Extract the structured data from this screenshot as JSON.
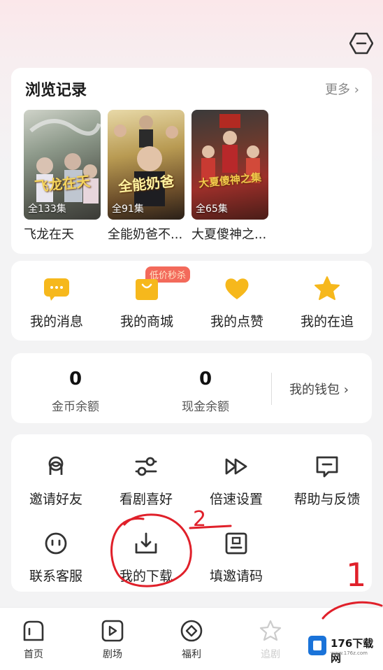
{
  "history": {
    "title": "浏览记录",
    "more": "更多",
    "items": [
      {
        "title": "飞龙在天",
        "episodes": "全133集",
        "poster_text": "飞龙在天"
      },
      {
        "title": "全能奶爸不...",
        "episodes": "全91集",
        "poster_text": "全能奶爸"
      },
      {
        "title": "大夏傻神之...",
        "episodes": "全65集",
        "poster_text": "大夏傻神之集"
      }
    ]
  },
  "quick": {
    "promo_badge": "低价秒杀",
    "items": [
      {
        "label": "我的消息",
        "icon": "message-icon"
      },
      {
        "label": "我的商城",
        "icon": "store-icon"
      },
      {
        "label": "我的点赞",
        "icon": "heart-icon"
      },
      {
        "label": "我的在追",
        "icon": "star-icon"
      }
    ]
  },
  "wallet": {
    "coins_value": "0",
    "coins_label": "金币余额",
    "cash_value": "0",
    "cash_label": "现金余额",
    "wallet_link": "我的钱包"
  },
  "tools": {
    "items": [
      {
        "label": "邀请好友",
        "icon": "invite-icon"
      },
      {
        "label": "看剧喜好",
        "icon": "preference-icon"
      },
      {
        "label": "倍速设置",
        "icon": "speed-icon"
      },
      {
        "label": "帮助与反馈",
        "icon": "feedback-icon"
      },
      {
        "label": "联系客服",
        "icon": "service-icon"
      },
      {
        "label": "我的下载",
        "icon": "download-icon"
      },
      {
        "label": "填邀请码",
        "icon": "invite-code-icon"
      }
    ]
  },
  "tabbar": {
    "items": [
      {
        "label": "首页",
        "icon": "home-icon"
      },
      {
        "label": "剧场",
        "icon": "theater-icon"
      },
      {
        "label": "福利",
        "icon": "welfare-icon"
      },
      {
        "label": "追剧",
        "icon": "follow-icon"
      }
    ]
  },
  "annotations": {
    "mark_2": "2",
    "mark_1": "1"
  },
  "watermark": {
    "text": "176下载网",
    "sub": "www.176z.com"
  },
  "colors": {
    "accent_yellow": "#f6b81c",
    "promo_red": "#f25a4a",
    "annotation_red": "#e0202a"
  }
}
